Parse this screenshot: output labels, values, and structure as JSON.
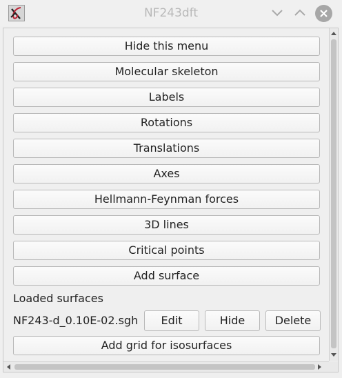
{
  "window": {
    "title": "NF243dft",
    "app_icon": "molden-app-icon",
    "controls": {
      "minimize_icon": "chevron-down-icon",
      "maximize_icon": "chevron-up-icon",
      "close_icon": "close-icon"
    }
  },
  "menu": {
    "buttons": [
      {
        "label": "Hide this menu"
      },
      {
        "label": "Molecular skeleton"
      },
      {
        "label": "Labels"
      },
      {
        "label": "Rotations"
      },
      {
        "label": "Translations"
      },
      {
        "label": "Axes"
      },
      {
        "label": "Hellmann-Feynman forces"
      },
      {
        "label": "3D lines"
      },
      {
        "label": "Critical points"
      },
      {
        "label": "Add surface"
      }
    ],
    "loaded_surfaces_label": "Loaded surfaces",
    "surfaces": [
      {
        "name": "NF243-d_0.10E-02.sgh",
        "edit_label": "Edit",
        "hide_label": "Hide",
        "delete_label": "Delete"
      }
    ],
    "add_grid_label": "Add grid for isosurfaces"
  },
  "colors": {
    "close_button_bg": "#a7a7a7",
    "title_text": "#b9b9b9",
    "window_bg": "#efefef"
  }
}
